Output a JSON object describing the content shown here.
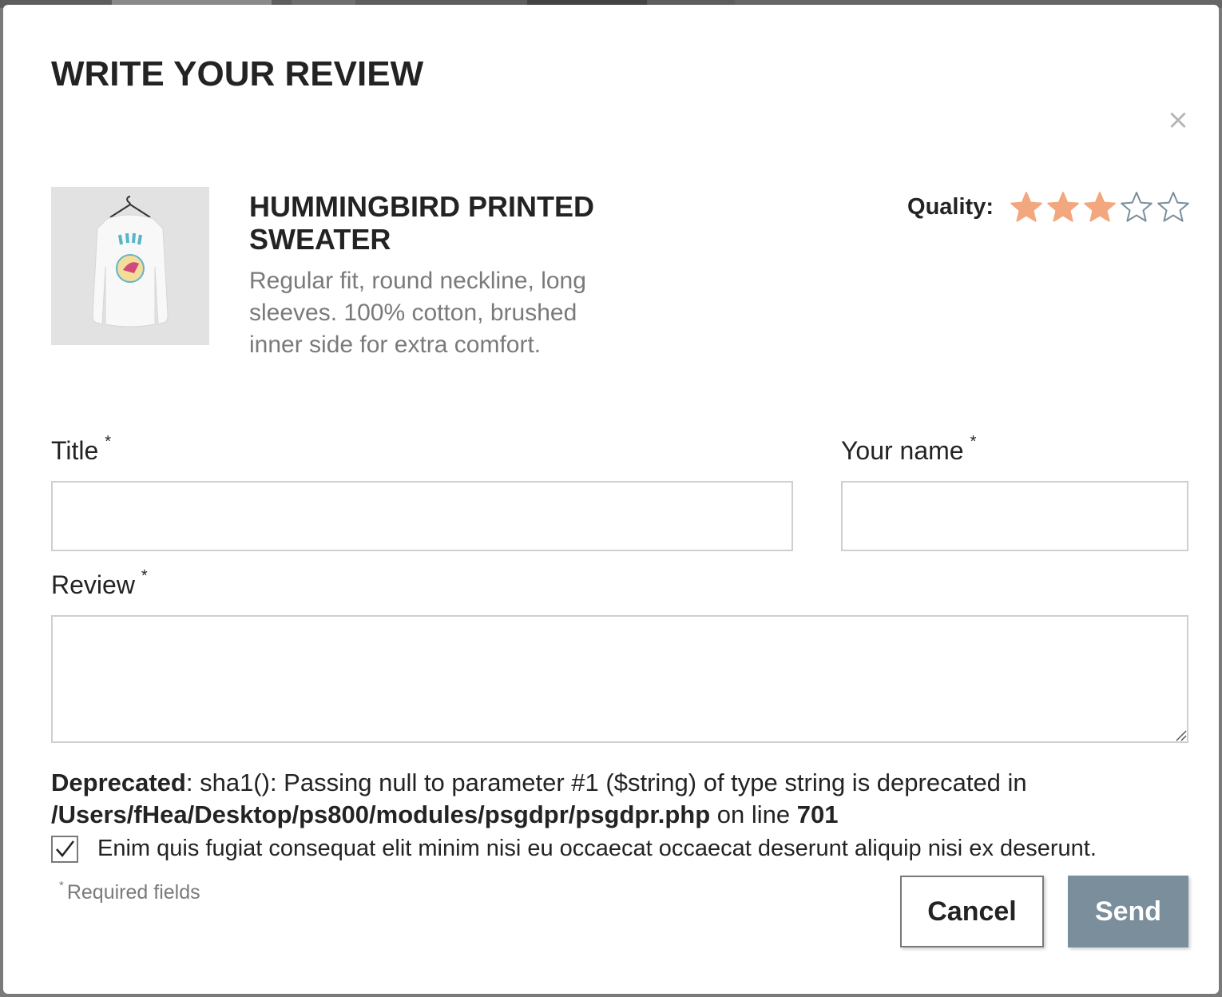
{
  "modal": {
    "title": "WRITE YOUR REVIEW",
    "close_glyph": "×"
  },
  "product": {
    "name": "HUMMINGBIRD PRINTED SWEATER",
    "description": "Regular fit, round neckline, long sleeves. 100% cotton, brushed inner side for extra comfort.",
    "image_icon": "sweater-image"
  },
  "rating": {
    "label": "Quality:",
    "value": 3,
    "max": 5,
    "filled_color": "#f3a77e",
    "empty_color": "#7a8f9b"
  },
  "form": {
    "title_label": "Title",
    "name_label": "Your name",
    "review_label": "Review",
    "required_marker": "*",
    "title_value": "",
    "name_value": "",
    "review_value": ""
  },
  "warning": {
    "level": "Deprecated",
    "message": ": sha1(): Passing null to parameter #1 ($string) of type string is deprecated in ",
    "file": "/Users/fHea/Desktop/ps800/modules/psgdpr/psgdpr.php",
    "line_text": " on line ",
    "line": "701"
  },
  "consent": {
    "checked": true,
    "text": "Enim quis fugiat consequat elit minim nisi eu occaecat occaecat deserunt aliquip nisi ex deserunt."
  },
  "footer": {
    "required_marker": "*",
    "required_note": "Required fields",
    "cancel_label": "Cancel",
    "send_label": "Send"
  },
  "colors": {
    "send_button": "#7a8f9b",
    "star_filled": "#f3a77e"
  }
}
